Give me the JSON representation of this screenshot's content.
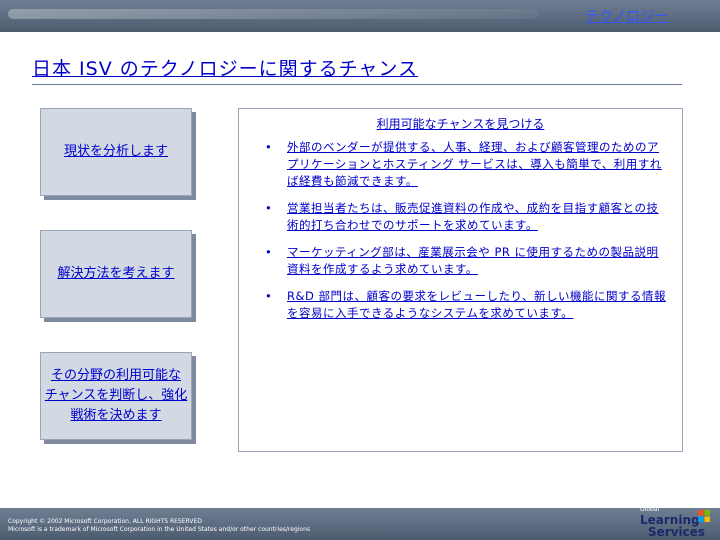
{
  "header": {
    "category_label": "テクノロジー"
  },
  "title": "日本 ISV のテクノロジーに関するチャンス",
  "steps": [
    {
      "label": "現状を分析します"
    },
    {
      "label": "解決方法を考えます"
    },
    {
      "label_lines": [
        "その分野の利用可能な",
        "チャンスを判断し、強化",
        "戦術を決めます"
      ]
    }
  ],
  "panel": {
    "heading": "利用可能なチャンスを見つける",
    "bullets": [
      {
        "marker": "•",
        "text": "外部のベンダーが提供する、人事、経理、および顧客管理のためのアプリケーションとホスティング サービスは、導入も簡単で、利用すれば経費も節減できます。"
      },
      {
        "marker": "•",
        "text": "営業担当者たちは、販売促進資料の作成や、成約を目指す顧客との技術的打ち合わせでのサポートを求めています。"
      },
      {
        "marker": "•",
        "text": "マーケッティング部は、産業展示会や PR に使用するための製品説明資料を作成するよう求めています。"
      },
      {
        "marker": "•",
        "text": "R&D 部門は、顧客の要求をレビューしたり、新しい機能に関する情報を容易に入手できるようなシステムを求めています。"
      }
    ]
  },
  "footer": {
    "copyright_line1": "Copyright © 2002 Microsoft Corporation. ALL RIGHTS RESERVED",
    "copyright_line2": "Microsoft is a trademark of Microsoft Corporation in the United States and/or other countries/regions",
    "logo_global": "Global",
    "logo_learning": "Learning",
    "logo_services": "Services"
  },
  "colors": {
    "accent_text": "#0000cc",
    "band": "#5a6a80",
    "step_box": "#d3d9e3"
  }
}
